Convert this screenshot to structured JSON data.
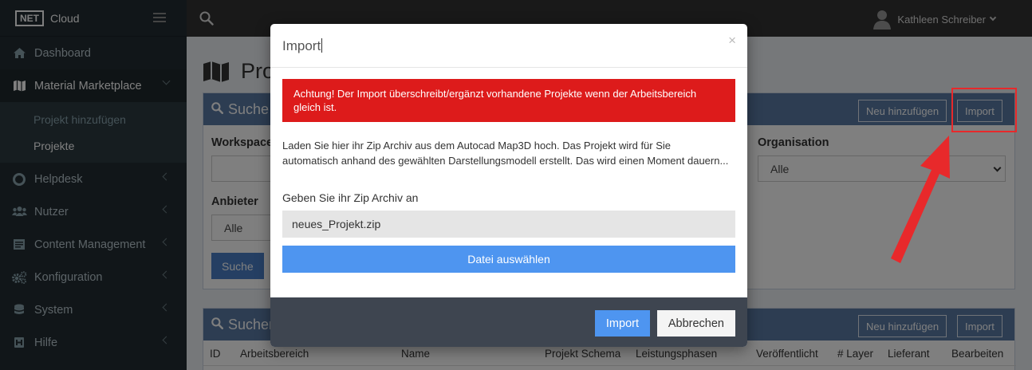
{
  "brand": {
    "logo": "NET",
    "name": "Cloud"
  },
  "sidebar": {
    "items": [
      {
        "label": "Dashboard",
        "icon": "home-icon"
      },
      {
        "label": "Material Marketplace",
        "icon": "map-icon",
        "expanded": true,
        "children": [
          {
            "label": "Projekt hinzufügen"
          },
          {
            "label": "Projekte"
          }
        ]
      },
      {
        "label": "Helpdesk",
        "icon": "lifebuoy-icon"
      },
      {
        "label": "Nutzer",
        "icon": "users-icon"
      },
      {
        "label": "Content Management",
        "icon": "content-icon"
      },
      {
        "label": "Konfiguration",
        "icon": "cogs-icon"
      },
      {
        "label": "System",
        "icon": "database-icon"
      },
      {
        "label": "Hilfe",
        "icon": "help-icon"
      }
    ]
  },
  "topbar": {
    "user_name": "Kathleen Schreiber"
  },
  "page": {
    "title": "Pro"
  },
  "search_box": {
    "title": "Suche",
    "new_button": "Neu hinzufügen",
    "import_button": "Import",
    "workspace_label": "Workspace",
    "organisation_label": "Organisation",
    "organisation_value": "Alle",
    "anbieter_label": "Anbieter",
    "anbieter_value": "Alle",
    "search_button": "Suche"
  },
  "results_box": {
    "title": "Sucher",
    "new_button": "Neu hinzufügen",
    "import_button": "Import",
    "columns": [
      "ID",
      "Arbeitsbereich",
      "Name",
      "Projekt Schema",
      "Leistungsphasen",
      "Veröffentlicht",
      "# Layer",
      "Lieferant",
      "Bearbeiten"
    ]
  },
  "modal": {
    "title": "Import",
    "close": "×",
    "alert": "Achtung! Der Import überschreibt/ergänzt vorhandene Projekte wenn der Arbeitsbereich gleich ist.",
    "intro": "Laden Sie hier ihr Zip Archiv aus dem Autocad Map3D hoch. Das Projekt wird für Sie automatisch anhand des gewählten Darstellungsmodell erstellt. Das wird einen Moment dauern...",
    "file_label": "Geben Sie ihr Zip Archiv an",
    "file_value": "neues_Projekt.zip",
    "choose_button": "Datei auswählen",
    "import_button": "Import",
    "cancel_button": "Abbrechen"
  },
  "colors": {
    "alert": "#dd1b1b",
    "primary": "#4e95f0",
    "annotation": "#e8292b"
  }
}
